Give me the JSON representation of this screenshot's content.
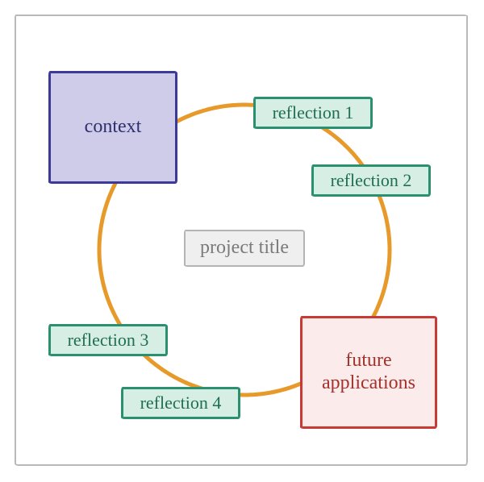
{
  "diagram": {
    "center_label": "project title",
    "context_label": "context",
    "future_label": "future\napplications",
    "reflections": {
      "r1": "reflection 1",
      "r2": "reflection 2",
      "r3": "reflection 3",
      "r4": "reflection 4"
    },
    "colors": {
      "ring": "#e79a2a",
      "context_border": "#3d3996",
      "context_fill": "#cfcce9",
      "future_border": "#c83a34",
      "future_fill": "#fbeceb",
      "reflection_border": "#2a9070",
      "reflection_fill": "#d6eee3",
      "title_border": "#b4b4b4",
      "title_fill": "#efefef",
      "frame": "#b9b9b9"
    }
  }
}
